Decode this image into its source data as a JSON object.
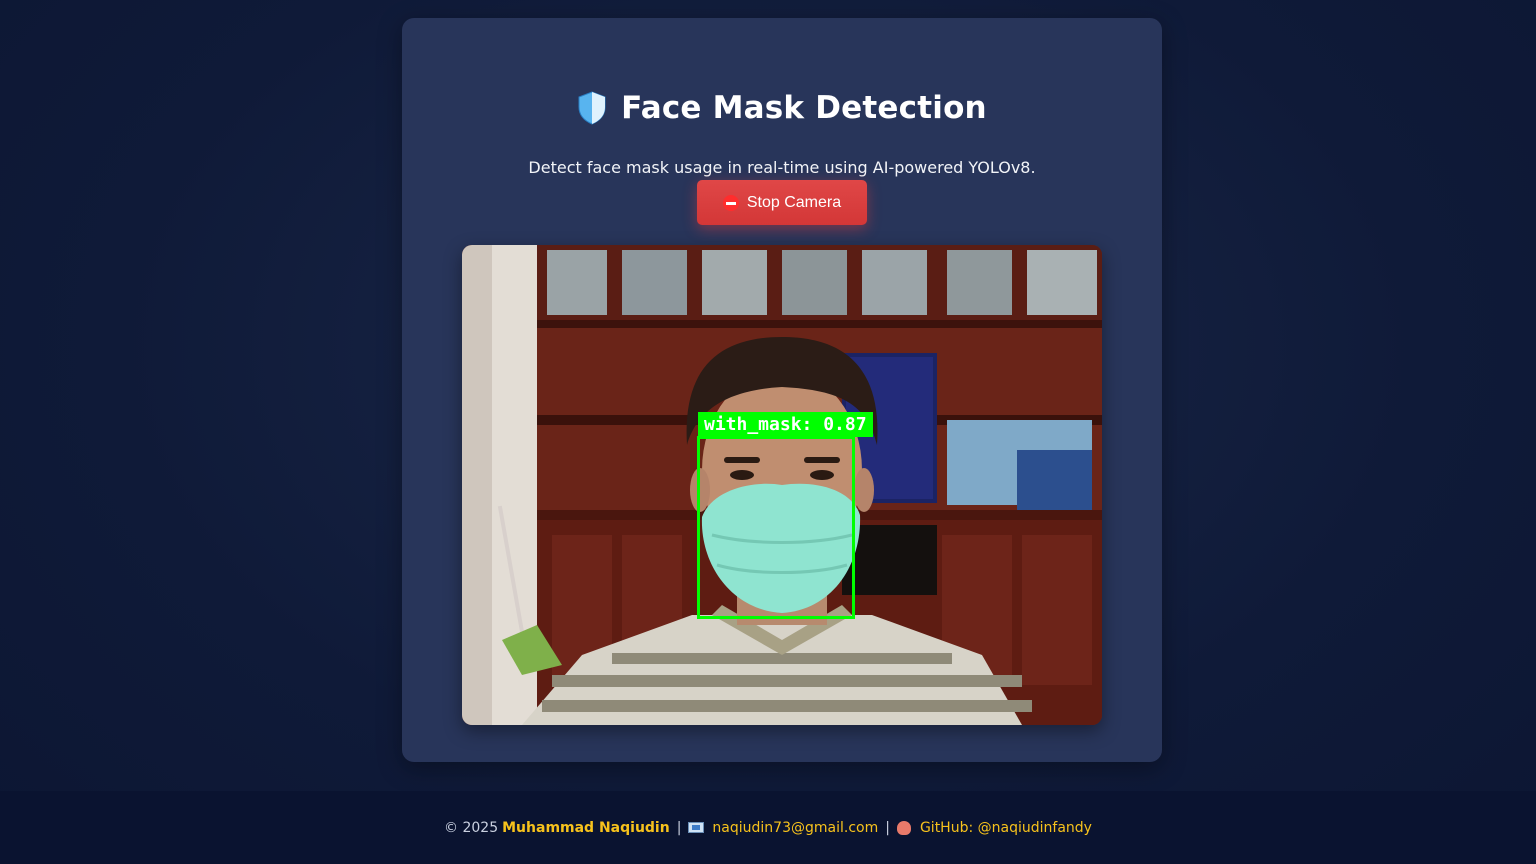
{
  "header": {
    "title": "Face Mask Detection",
    "subtitle": "Detect face mask usage in real-time using AI-powered YOLOv8.",
    "shield_icon": "shield-icon"
  },
  "controls": {
    "stop_label": "Stop Camera",
    "stop_icon": "no-entry-icon",
    "accent_color": "#dc3f3f"
  },
  "detection": {
    "label": "with_mask: 0.87",
    "box_color": "#00ff00"
  },
  "footer": {
    "copyright": "© 2025",
    "author": "Muhammad Naqiudin",
    "separator": "|",
    "email": "naqiudin73@gmail.com",
    "github": "GitHub: @naqiudinfandy",
    "mail_icon": "envelope-icon",
    "github_icon": "octopus-icon",
    "highlight_color": "#f7c21c"
  }
}
